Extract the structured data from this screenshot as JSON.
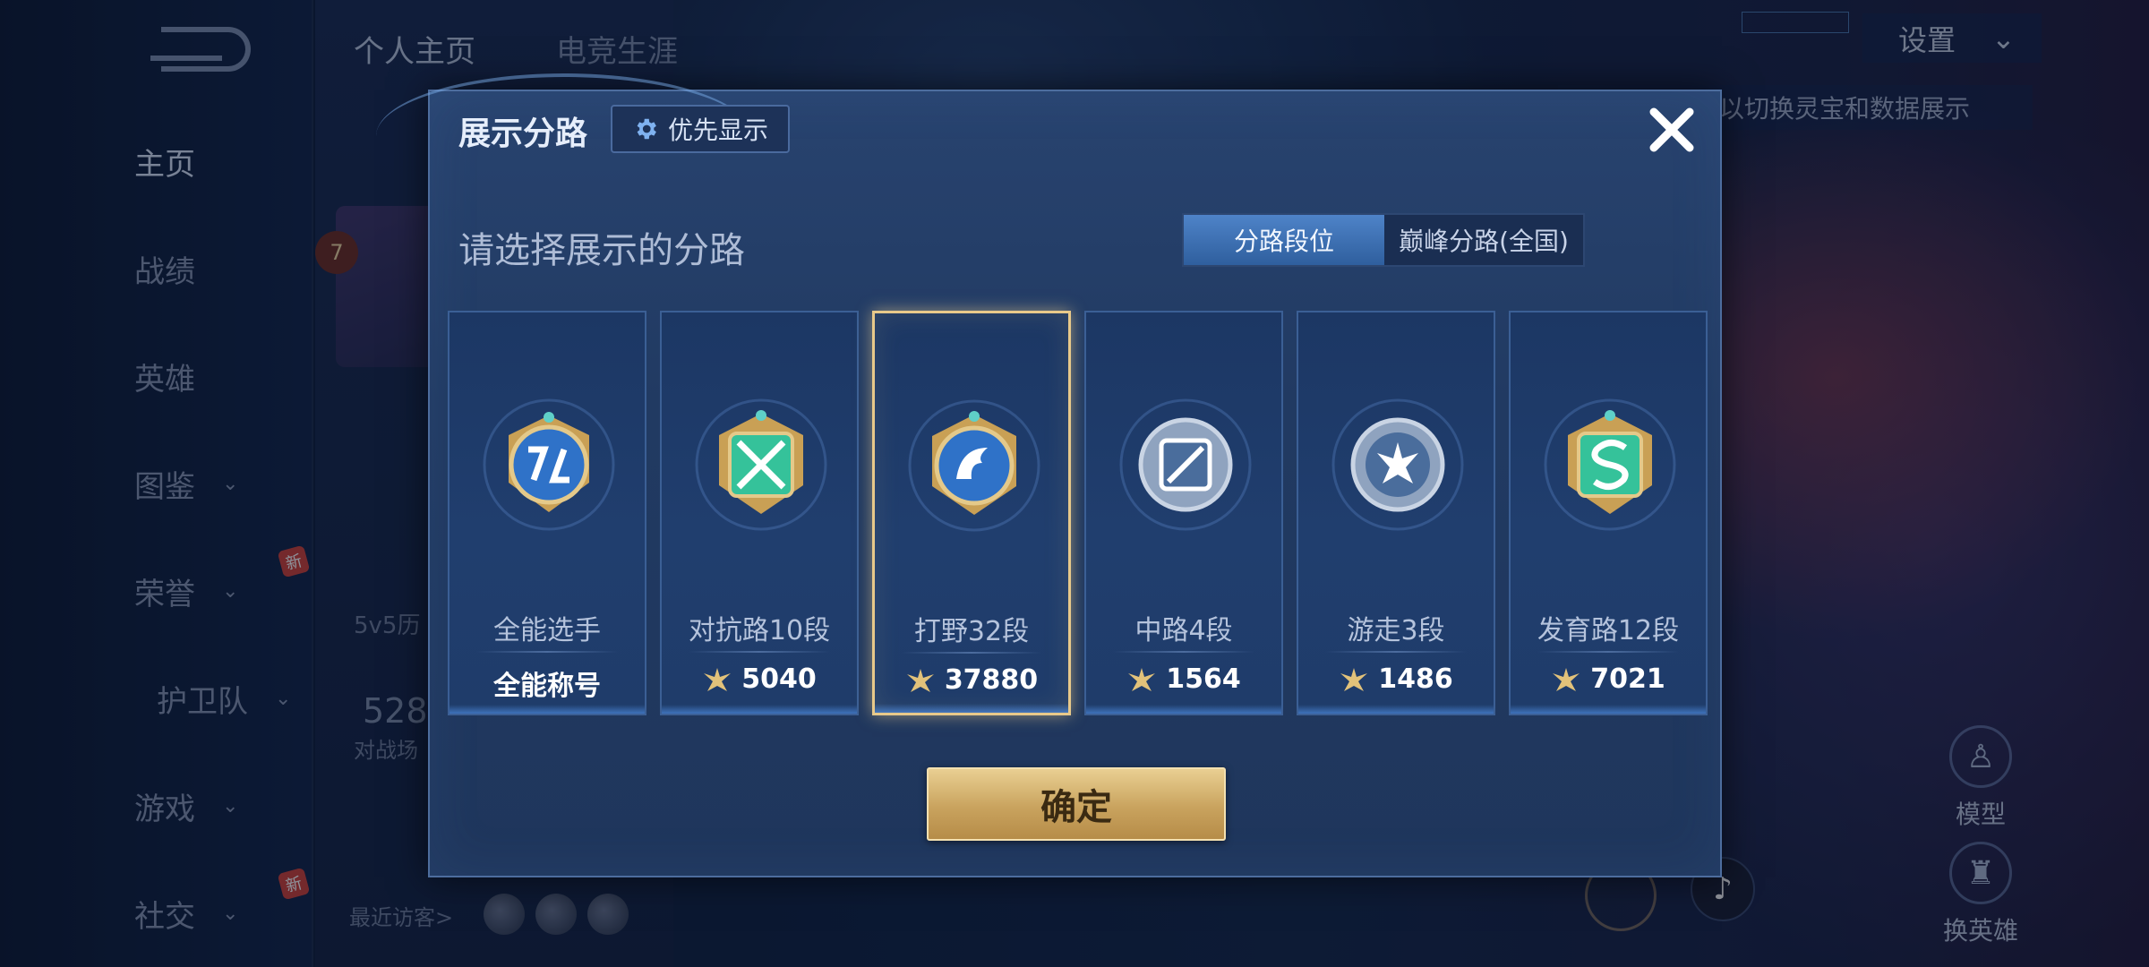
{
  "nav": {
    "items": [
      {
        "label": "主页",
        "active": true,
        "chevron": false
      },
      {
        "label": "战绩",
        "active": false,
        "chevron": false
      },
      {
        "label": "英雄",
        "active": false,
        "chevron": false
      },
      {
        "label": "图鉴",
        "active": false,
        "chevron": true
      },
      {
        "label": "荣誉",
        "active": false,
        "chevron": true
      },
      {
        "label": "护卫队",
        "active": false,
        "chevron": true
      },
      {
        "label": "游戏",
        "active": false,
        "chevron": true
      },
      {
        "label": "社交",
        "active": false,
        "chevron": true
      }
    ],
    "new_badge": "新"
  },
  "profile": {
    "tabs": [
      "个人主页",
      "电竞生涯"
    ],
    "level": "7",
    "history_label": "5v5历",
    "matches_count": "528",
    "matches_label": "对战场",
    "visitors_label": "最近访客>"
  },
  "topbar": {
    "settings_label": "设置",
    "settings_chevron": "⌄",
    "hint_text": "以切换灵宝和数据展示"
  },
  "right_actions": {
    "model_label": "模型",
    "change_hero_label": "换英雄"
  },
  "modal": {
    "title": "展示分路",
    "priority_label": "优先显示",
    "heading": "请选择展示的分路",
    "tabs": {
      "lane_rank": "分路段位",
      "peak_lane": "巅峰分路(全国)"
    },
    "active_tab": "lane_rank",
    "cards": [
      {
        "name": "全能选手",
        "value": "全能称号",
        "has_points_icon": false,
        "emblem": "all-round-emblem-icon",
        "selected": false
      },
      {
        "name": "对抗路10段",
        "value": "5040",
        "has_points_icon": true,
        "emblem": "clash-lane-emblem-icon",
        "selected": false
      },
      {
        "name": "打野32段",
        "value": "37880",
        "has_points_icon": true,
        "emblem": "jungle-emblem-icon",
        "selected": true
      },
      {
        "name": "中路4段",
        "value": "1564",
        "has_points_icon": true,
        "emblem": "mid-lane-emblem-icon",
        "selected": false
      },
      {
        "name": "游走3段",
        "value": "1486",
        "has_points_icon": true,
        "emblem": "roam-emblem-icon",
        "selected": false
      },
      {
        "name": "发育路12段",
        "value": "7021",
        "has_points_icon": true,
        "emblem": "farm-lane-emblem-icon",
        "selected": false
      }
    ],
    "confirm_label": "确定"
  },
  "colors": {
    "accent_gold": "#e8c98a",
    "active_tab_blue": "#4e83c8",
    "modal_bg": "#23406b"
  }
}
